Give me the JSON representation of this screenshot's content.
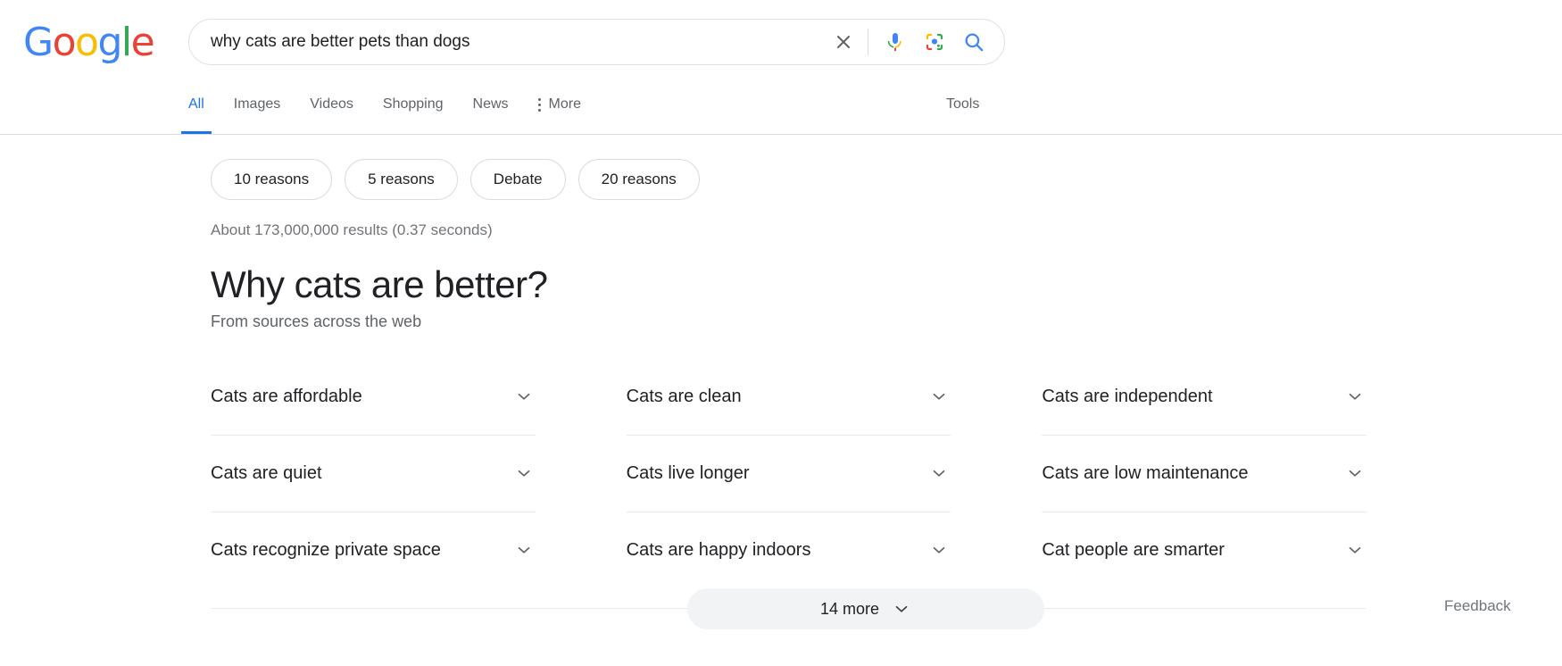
{
  "brand": {
    "logo_letters": [
      {
        "char": "G",
        "color": "#4285F4"
      },
      {
        "char": "o",
        "color": "#EA4335"
      },
      {
        "char": "o",
        "color": "#FBBC05"
      },
      {
        "char": "g",
        "color": "#4285F4"
      },
      {
        "char": "l",
        "color": "#34A853"
      },
      {
        "char": "e",
        "color": "#EA4335"
      }
    ]
  },
  "search": {
    "query": "why cats are better pets than dogs",
    "placeholder": "Search",
    "clear_icon": "close-icon",
    "voice_icon": "microphone-icon",
    "lens_icon": "google-lens-icon",
    "submit_icon": "search-icon"
  },
  "nav": {
    "tabs": [
      {
        "label": "All",
        "active": true
      },
      {
        "label": "Images",
        "active": false
      },
      {
        "label": "Videos",
        "active": false
      },
      {
        "label": "Shopping",
        "active": false
      },
      {
        "label": "News",
        "active": false
      }
    ],
    "more_label": "More",
    "more_icon": "vertical-dots-icon",
    "tools_label": "Tools",
    "active_color": "#1a73e8"
  },
  "filters": {
    "chips": [
      "10 reasons",
      "5 reasons",
      "Debate",
      "20 reasons"
    ]
  },
  "results": {
    "stats": "About 173,000,000 results (0.37 seconds)"
  },
  "panel": {
    "title": "Why cats are better?",
    "subtitle": "From sources across the web",
    "items": [
      {
        "label": "Cats are affordable",
        "icon": "chevron-down-icon"
      },
      {
        "label": "Cats are clean",
        "icon": "chevron-down-icon"
      },
      {
        "label": "Cats are independent",
        "icon": "chevron-down-icon"
      },
      {
        "label": "Cats are quiet",
        "icon": "chevron-down-icon"
      },
      {
        "label": "Cats live longer",
        "icon": "chevron-down-icon"
      },
      {
        "label": "Cats are low maintenance",
        "icon": "chevron-down-icon"
      },
      {
        "label": "Cats recognize private space",
        "icon": "chevron-down-icon"
      },
      {
        "label": "Cats are happy indoors",
        "icon": "chevron-down-icon"
      },
      {
        "label": "Cat people are smarter",
        "icon": "chevron-down-icon"
      }
    ],
    "more_label": "14 more",
    "more_icon": "chevron-down-icon",
    "feedback_label": "Feedback"
  }
}
